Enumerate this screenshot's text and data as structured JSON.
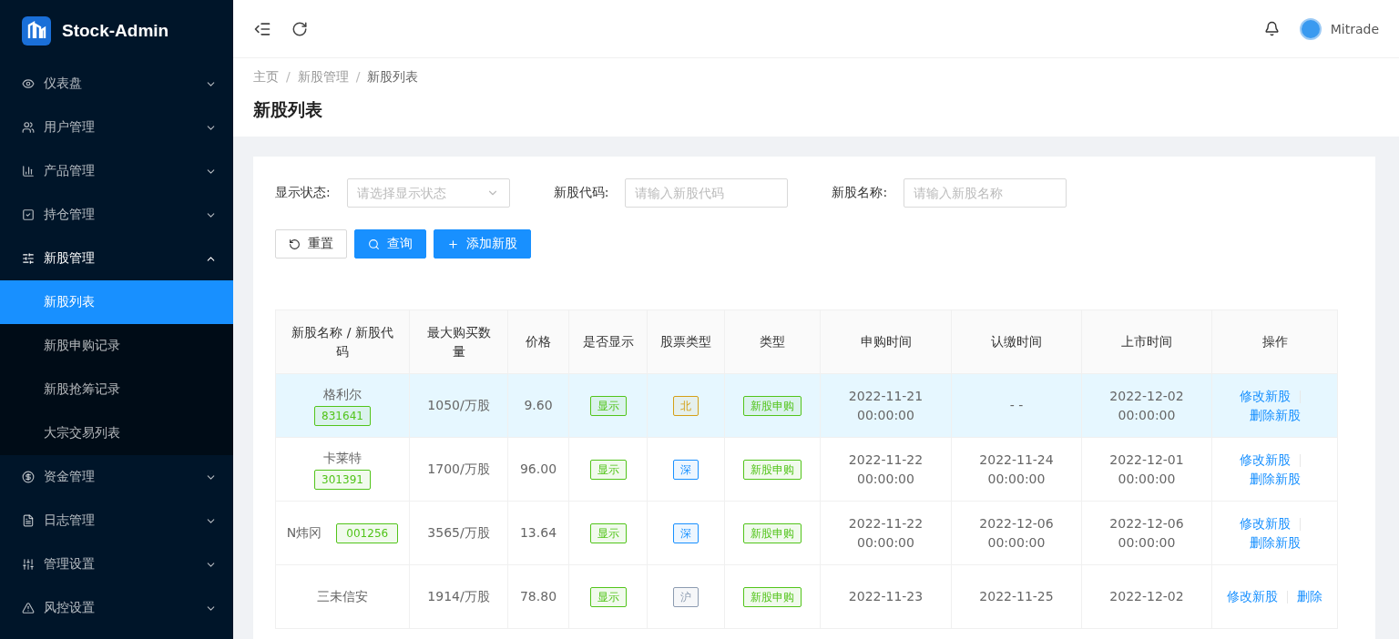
{
  "brand": {
    "name": "Stock-Admin"
  },
  "sidebar": {
    "items": [
      {
        "label": "仪表盘",
        "expanded": false
      },
      {
        "label": "用户管理",
        "expanded": false
      },
      {
        "label": "产品管理",
        "expanded": false
      },
      {
        "label": "持仓管理",
        "expanded": false
      },
      {
        "label": "新股管理",
        "expanded": true,
        "children": [
          {
            "label": "新股列表",
            "selected": true
          },
          {
            "label": "新股申购记录",
            "selected": false
          },
          {
            "label": "新股抢筹记录",
            "selected": false
          },
          {
            "label": "大宗交易列表",
            "selected": false
          }
        ]
      },
      {
        "label": "资金管理",
        "expanded": false
      },
      {
        "label": "日志管理",
        "expanded": false
      },
      {
        "label": "管理设置",
        "expanded": false
      },
      {
        "label": "风控设置",
        "expanded": false
      }
    ]
  },
  "header": {
    "user": "Mitrade"
  },
  "breadcrumb": [
    {
      "kind": "link",
      "label": "主页"
    },
    {
      "kind": "separator",
      "label": "/"
    },
    {
      "kind": "link",
      "label": "新股管理"
    },
    {
      "kind": "separator",
      "label": "/"
    },
    {
      "kind": "current",
      "label": "新股列表"
    }
  ],
  "page_title": "新股列表",
  "filters": [
    {
      "kind": "select",
      "label": "显示状态:",
      "placeholder": "请选择显示状态"
    },
    {
      "kind": "input",
      "label": "新股代码:",
      "placeholder": "请输入新股代码"
    },
    {
      "kind": "input",
      "label": "新股名称:",
      "placeholder": "请输入新股名称"
    }
  ],
  "buttons": [
    {
      "kind": "reset",
      "label": "重置"
    },
    {
      "kind": "search",
      "label": "查询"
    },
    {
      "kind": "add",
      "label": "添加新股"
    }
  ],
  "table": {
    "columns": [
      "新股名称 / 新股代码",
      "最大购买数量",
      "价格",
      "是否显示",
      "股票类型",
      "类型",
      "申购时间",
      "认缴时间",
      "上市时间",
      "操作"
    ],
    "rows": [
      {
        "selected": true,
        "name": "格利尔",
        "code": "831641",
        "code_inline": false,
        "max_qty": "1050/万股",
        "price": "9.60",
        "display": "显示",
        "market": {
          "label": "北",
          "color": "#d4a017"
        },
        "type": "新股申购",
        "subscribe_time": "2022-11-21 00:00:00",
        "pay_time": "- -",
        "list_time": "2022-12-02 00:00:00",
        "actions": [
          "修改新股",
          "删除新股"
        ]
      },
      {
        "selected": false,
        "name": "卡莱特",
        "code": "301391",
        "code_inline": false,
        "max_qty": "1700/万股",
        "price": "96.00",
        "display": "显示",
        "market": {
          "label": "深",
          "color": "#1890ff"
        },
        "type": "新股申购",
        "subscribe_time": "2022-11-22 00:00:00",
        "pay_time": "2022-11-24 00:00:00",
        "list_time": "2022-12-01 00:00:00",
        "actions": [
          "修改新股",
          "删除新股"
        ]
      },
      {
        "selected": false,
        "name": "N炜冈",
        "code": "001256",
        "code_inline": true,
        "max_qty": "3565/万股",
        "price": "13.64",
        "display": "显示",
        "market": {
          "label": "深",
          "color": "#1890ff"
        },
        "type": "新股申购",
        "subscribe_time": "2022-11-22 00:00:00",
        "pay_time": "2022-12-06 00:00:00",
        "list_time": "2022-12-06 00:00:00",
        "actions": [
          "修改新股",
          "删除新股"
        ]
      },
      {
        "selected": false,
        "name": "三未信安",
        "max_qty": "1914/万股",
        "price": "78.80",
        "display": "显示",
        "market": {
          "label": "沪",
          "color": "#8c9bb0"
        },
        "type": "新股申购",
        "subscribe_time": "2022-11-23",
        "pay_time": "2022-11-25",
        "list_time": "2022-12-02",
        "actions": [
          "修改新股",
          "删除"
        ]
      }
    ]
  }
}
